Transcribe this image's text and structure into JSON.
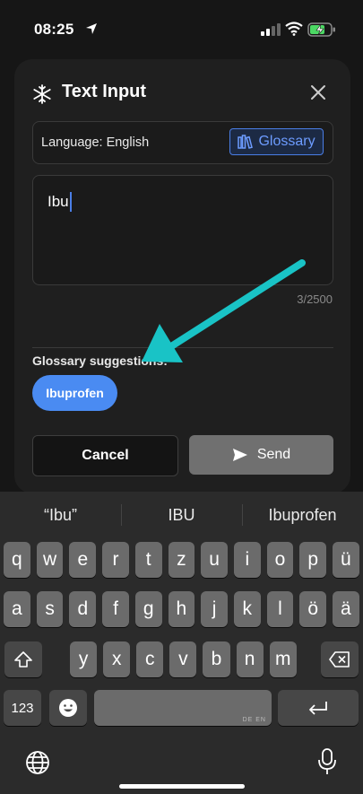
{
  "status_bar": {
    "time": "08:25"
  },
  "modal": {
    "title": "Text Input",
    "language_label": "Language: English",
    "glossary_button": "Glossary",
    "input_value": "Ibu",
    "char_counter": "3/2500",
    "suggestions_title": "Glossary suggestions:",
    "suggestions": [
      "Ibuprofen"
    ],
    "cancel_label": "Cancel",
    "send_label": "Send"
  },
  "keyboard": {
    "predictions": [
      "“Ibu”",
      "IBU",
      "Ibuprofen"
    ],
    "row1": [
      "q",
      "w",
      "e",
      "r",
      "t",
      "z",
      "u",
      "i",
      "o",
      "p",
      "ü"
    ],
    "row2": [
      "a",
      "s",
      "d",
      "f",
      "g",
      "h",
      "j",
      "k",
      "l",
      "ö",
      "ä"
    ],
    "row3": [
      "y",
      "x",
      "c",
      "v",
      "b",
      "n",
      "m"
    ],
    "numbers_key": "123",
    "space_lang": "DE EN"
  },
  "colors": {
    "accent_blue": "#4a8bf2",
    "annotation_arrow": "#19c3c6",
    "send_button": "#707070"
  }
}
